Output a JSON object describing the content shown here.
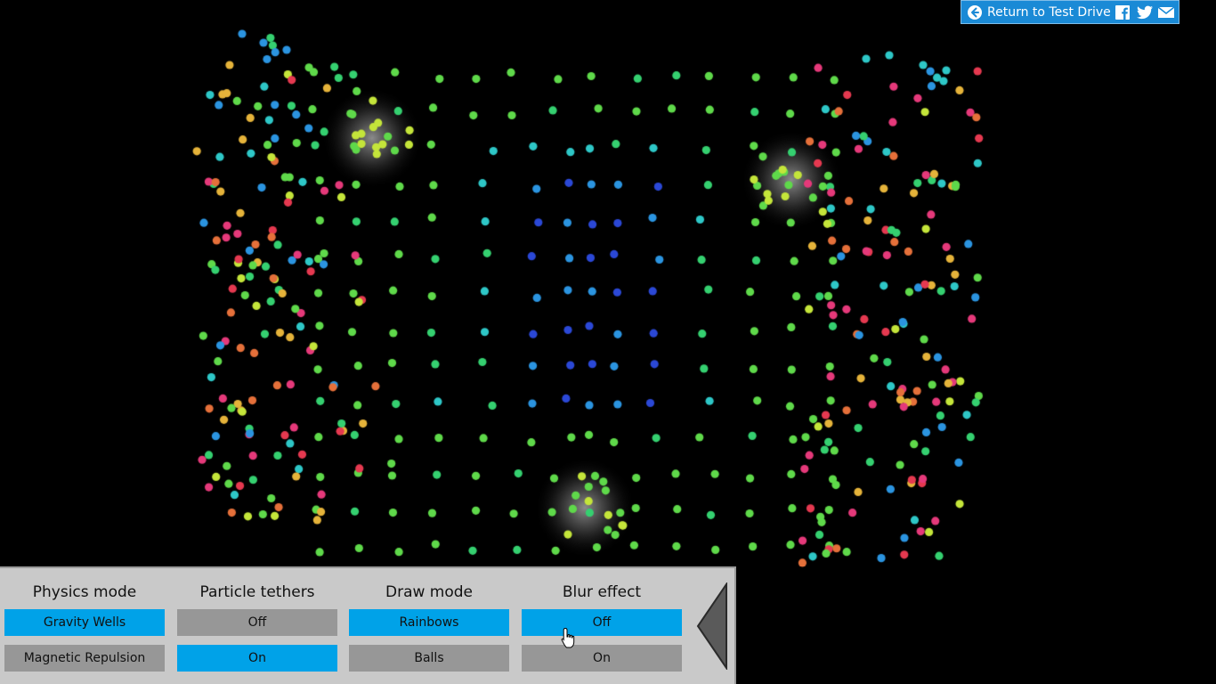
{
  "topbar": {
    "return_label": "Return to Test Drive",
    "icons": [
      "back-arrow-icon",
      "facebook-icon",
      "twitter-icon",
      "email-icon"
    ]
  },
  "controls": [
    {
      "title": "Physics mode",
      "options": [
        "Gravity Wells",
        "Magnetic Repulsion"
      ],
      "selected": 0
    },
    {
      "title": "Particle tethers",
      "options": [
        "Off",
        "On"
      ],
      "selected": 1
    },
    {
      "title": "Draw mode",
      "options": [
        "Rainbows",
        "Balls"
      ],
      "selected": 0
    },
    {
      "title": "Blur effect",
      "options": [
        "Off",
        "On"
      ],
      "selected": 0
    }
  ],
  "collapse_icon": "left-triangle-icon",
  "colors": {
    "background": "#000000",
    "panel": "#c9c9c9",
    "option_active": "#00a2e8",
    "option_inactive": "#979797",
    "topbar": "#1a8ad6",
    "particle_palette": [
      "#e53950",
      "#e5397a",
      "#e5703a",
      "#e5b33a",
      "#c4e53a",
      "#5fd94a",
      "#35d070",
      "#2ec7c7",
      "#2b94e0",
      "#2b48d6"
    ]
  },
  "scene": {
    "gravity_wells": 3,
    "description_icon": "particle-field"
  }
}
